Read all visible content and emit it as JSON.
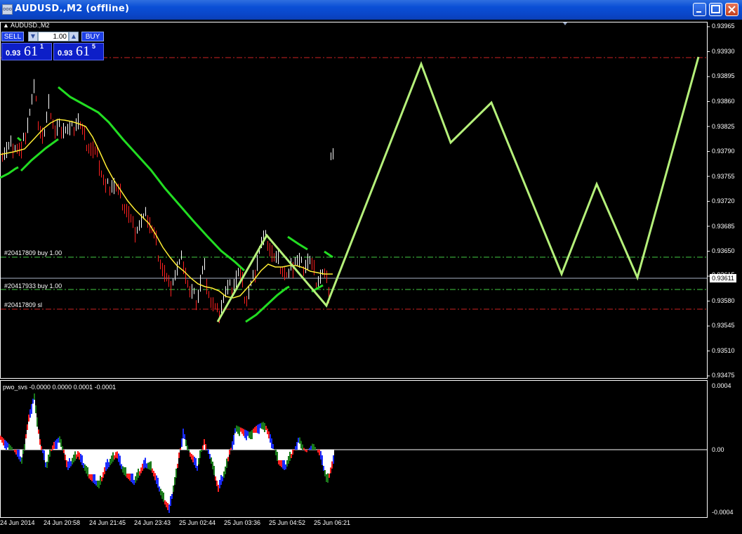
{
  "window": {
    "title": "AUDUSD.,M2 (offline)",
    "icon": "chart-window-icon",
    "buttons": [
      "minimize-icon",
      "maximize-icon",
      "close-icon"
    ]
  },
  "chart": {
    "symbol_label": "AUDUSD.,M2",
    "trade_panel": {
      "sell_label": "SELL",
      "buy_label": "BUY",
      "lot_value": "1.00",
      "sell_price_small": "0.93",
      "sell_price_big": "61",
      "sell_price_sup": "1",
      "buy_price_small": "0.93",
      "buy_price_big": "61",
      "buy_price_sup": "5"
    },
    "order_labels": [
      "#20417809 buy 1.00",
      "#20417933 buy 1.00",
      "#20417809 sl"
    ],
    "current_price": "0.93611",
    "price_axis": [
      "0.93965",
      "0.93930",
      "0.93895",
      "0.93860",
      "0.93825",
      "0.93790",
      "0.93755",
      "0.93720",
      "0.93685",
      "0.93650",
      "0.93615",
      "0.93580",
      "0.93545",
      "0.93510",
      "0.93475"
    ],
    "indicator": {
      "label": "pwo_svs -0.0000 0.0000 0.0001 -0.0001",
      "axis": [
        "0.0004",
        "0.00",
        "-0.0004"
      ]
    },
    "time_axis": [
      "24 Jun 2014",
      "24 Jun 20:58",
      "24 Jun 21:45",
      "24 Jun 23:43",
      "25 Jun 02:44",
      "25 Jun 03:36",
      "25 Jun 04:52",
      "25 Jun 06:21"
    ],
    "colors": {
      "background": "#000000",
      "bull_candle": "#ffffff",
      "bear_candle": "#ff0000",
      "ma_yellow": "#ffff33",
      "ma_green": "#22dd22",
      "zigzag": "#b5f07a",
      "buy_line": "#44cc44",
      "sl_line": "#ee2222",
      "grid_fg": "#ffffff"
    }
  }
}
